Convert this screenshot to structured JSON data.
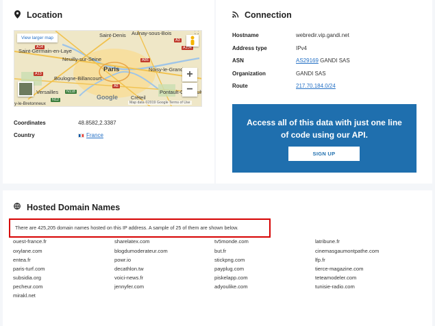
{
  "location": {
    "title": "Location",
    "map": {
      "larger_map_link": "View larger map",
      "labels": [
        "Saint-Denis",
        "Aulnay-sous-Bois",
        "Saint-Germain-en-Laye",
        "Neuilly-sur-Seine",
        "Paris",
        "Noisy-le-Grand",
        "Boulogne-Billancourt",
        "Versailles",
        "Pontault-Combault",
        "Créteil",
        "y-le-Bretonneux"
      ],
      "shields": [
        "A14",
        "A3",
        "A104",
        "A86",
        "A13",
        "N118",
        "N12",
        "A6"
      ],
      "zoom_in": "+",
      "zoom_out": "−",
      "logo": "Google",
      "footer": "Map data ©2019 Google   Terms of Use"
    },
    "coordinates_label": "Coordinates",
    "coordinates_value": "48.8582,2.3387",
    "country_label": "Country",
    "country_value": "France"
  },
  "connection": {
    "title": "Connection",
    "rows": [
      {
        "label": "Hostname",
        "value": "webredir.vip.gandi.net"
      },
      {
        "label": "Address type",
        "value": "IPv4"
      },
      {
        "label": "ASN",
        "value": "AS29169",
        "suffix": " GANDI SAS"
      },
      {
        "label": "Organization",
        "value": "GANDI SAS"
      },
      {
        "label": "Route",
        "value": "217.70.184.0/24"
      }
    ],
    "cta_text": "Access all of this data with just one line of code using our API.",
    "cta_button": "SIGN UP"
  },
  "domains": {
    "title": "Hosted Domain Names",
    "notice": "There are 425,205 domain names hosted on this IP address. A sample of 25 of them are shown below.",
    "columns": [
      [
        "ouest-france.fr",
        "oxylane.com",
        "entea.fr",
        "paris-turf.com",
        "subsidia.org",
        "pecheur.com",
        "mirakl.net"
      ],
      [
        "sharelatex.com",
        "blogdumoderateur.com",
        "powr.io",
        "decathlon.tw",
        "voici-news.fr",
        "jennyfer.com"
      ],
      [
        "tv5monde.com",
        "but.fr",
        "stickpng.com",
        "payplug.com",
        "piskelapp.com",
        "adyoulike.com"
      ],
      [
        "latribune.fr",
        "cinemasgaumontpathe.com",
        "lfp.fr",
        "tierce-magazine.com",
        "teteamodeler.com",
        "tunisie-radio.com"
      ]
    ]
  },
  "colors": {
    "cta": "#1f6fae",
    "link": "#2470c5",
    "highlight": "#d60000"
  }
}
